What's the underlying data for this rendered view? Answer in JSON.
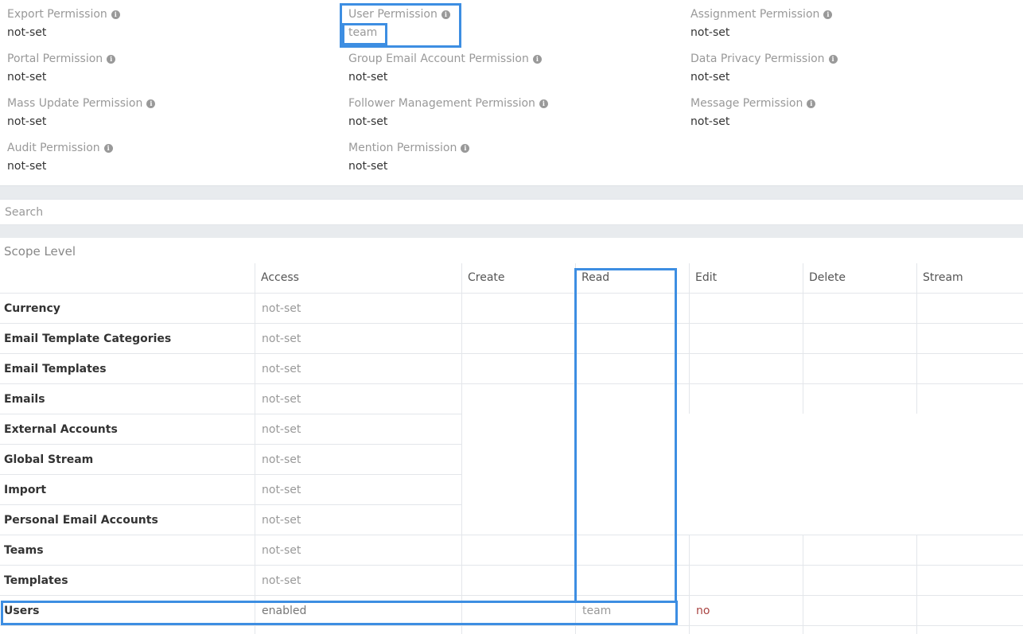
{
  "permissions": [
    {
      "label": "Export Permission",
      "value": "not-set"
    },
    {
      "label": "Portal Permission",
      "value": "not-set"
    },
    {
      "label": "Mass Update Permission",
      "value": "not-set"
    },
    {
      "label": "Audit Permission",
      "value": "not-set"
    },
    {
      "label": "User Permission",
      "value": "team"
    },
    {
      "label": "Group Email Account Permission",
      "value": "not-set"
    },
    {
      "label": "Follower Management Permission",
      "value": "not-set"
    },
    {
      "label": "Mention Permission",
      "value": "not-set"
    },
    {
      "label": "Assignment Permission",
      "value": "not-set"
    },
    {
      "label": "Data Privacy Permission",
      "value": "not-set"
    },
    {
      "label": "Message Permission",
      "value": "not-set"
    }
  ],
  "search": {
    "placeholder": "Search"
  },
  "scope": {
    "title": "Scope Level",
    "columns": [
      "Access",
      "Create",
      "Read",
      "Edit",
      "Delete",
      "Stream"
    ],
    "rows": [
      {
        "name": "Currency",
        "access": "not-set"
      },
      {
        "name": "Email Template Categories",
        "access": "not-set"
      },
      {
        "name": "Email Templates",
        "access": "not-set"
      },
      {
        "name": "Emails",
        "access": "not-set"
      },
      {
        "name": "External Accounts",
        "access": "not-set"
      },
      {
        "name": "Global Stream",
        "access": "not-set"
      },
      {
        "name": "Import",
        "access": "not-set"
      },
      {
        "name": "Personal Email Accounts",
        "access": "not-set"
      },
      {
        "name": "Teams",
        "access": "not-set"
      },
      {
        "name": "Templates",
        "access": "not-set"
      },
      {
        "name": "Users",
        "access": "enabled",
        "read": "team",
        "edit": "no"
      }
    ]
  },
  "colors": {
    "highlight": "#3d8ee2",
    "no_value": "#a94442",
    "muted": "#999999"
  }
}
